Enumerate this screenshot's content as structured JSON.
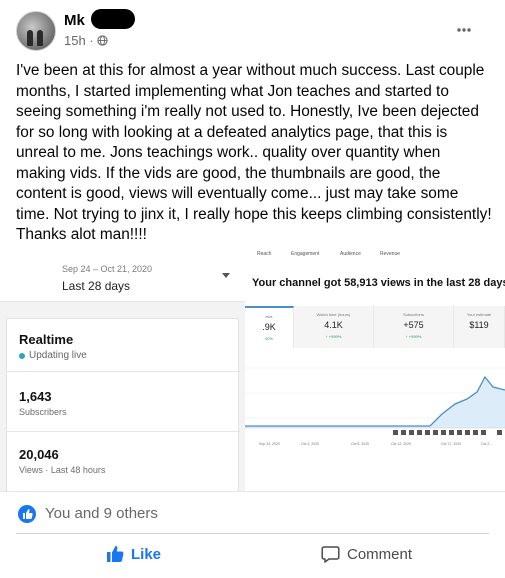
{
  "post": {
    "author": "Mk",
    "time": "15h",
    "privacy_icon": "globe-icon",
    "more_icon": "more-horizontal-icon",
    "text": "I've been at this for almost a year without much success. Last couple months, I started implementing what Jon teaches and started to seeing something i'm really not used to.  Honestly, Ive been dejected for so long with looking at a defeated analytics page, that this is unreal to me. Jons teachings work.. quality over quantity when making vids. If the vids are good, the thumbnails are good, the content is good, views will eventually come... just may take some time. Not trying to jinx it, I really hope this keeps climbing consistently! Thanks alot man!!!!"
  },
  "analytics": {
    "date_range": "Sep 24 – Oct 21, 2020",
    "date_label": "Last 28 days",
    "realtime": {
      "title": "Realtime",
      "status": "Updating live",
      "subscribers_value": "1,643",
      "subscribers_label": "Subscribers",
      "views_value": "20,046",
      "views_label": "Views · Last 48 hours"
    },
    "tabs": [
      "Reach",
      "Engagement",
      "Audience",
      "Revenue"
    ],
    "headline": "Your channel got 58,913 views in the last 28 days",
    "metrics": [
      {
        "label": "ews",
        "value": ".9K",
        "delta": "00%"
      },
      {
        "label": "Watch time (hours)",
        "value": "4.1K",
        "delta": "↑ +999%"
      },
      {
        "label": "Subscribers",
        "value": "+575",
        "delta": "↑ +999%"
      },
      {
        "label": "Your estimate",
        "value": "$119",
        "delta": ""
      }
    ],
    "chart_dates": [
      "Sep 24, 2020",
      "Oct 3, 2020",
      "Oct 8, 2020",
      "Oct 12, 2020",
      "Oct 17, 2020",
      "Oct 2..."
    ],
    "accent": "#4a90c8"
  },
  "reactions": {
    "text": "You and 9 others"
  },
  "actions": {
    "like": "Like",
    "comment": "Comment"
  },
  "colors": {
    "brand": "#1a77f2",
    "secondary_text": "#65676b"
  }
}
